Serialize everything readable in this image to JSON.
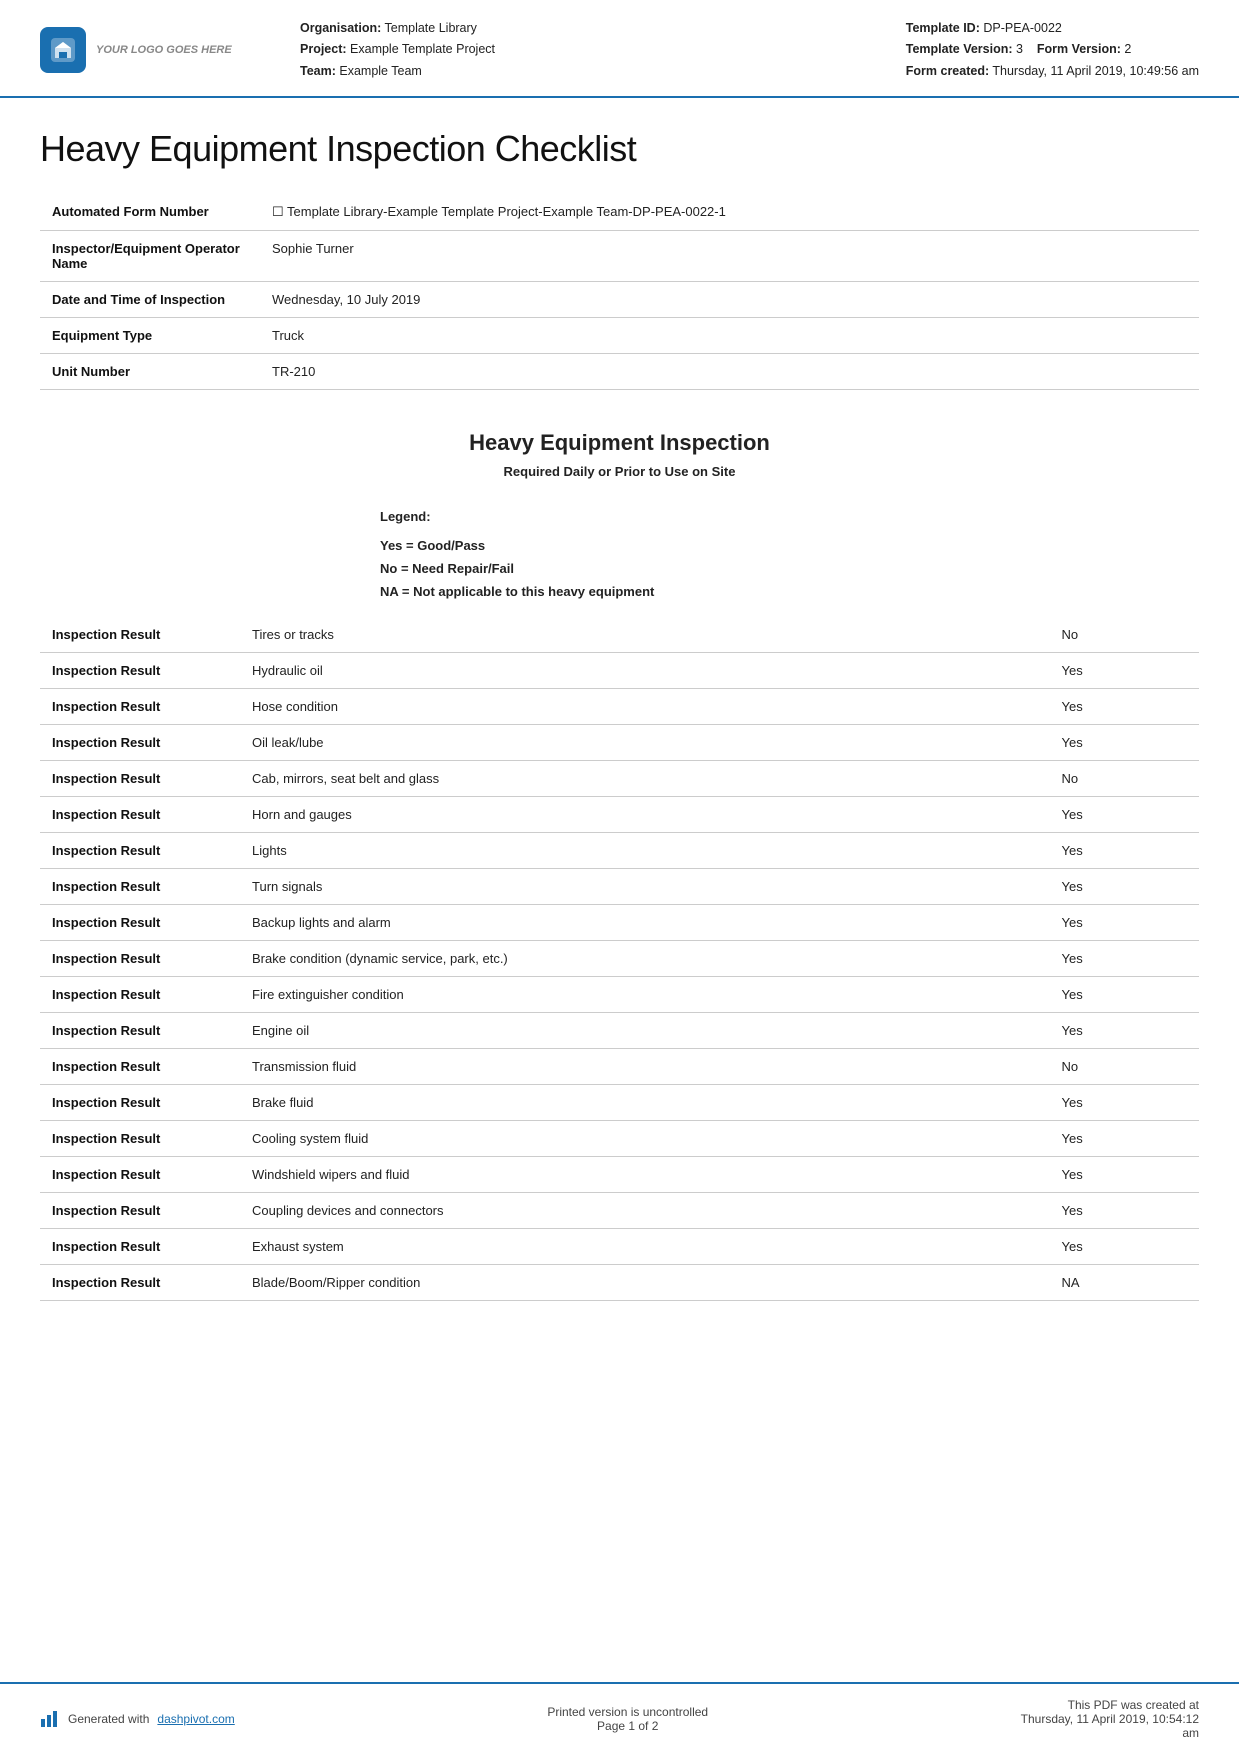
{
  "header": {
    "logo_alt": "Your Logo Goes Here",
    "org_label": "Organisation:",
    "org_value": "Template Library",
    "project_label": "Project:",
    "project_value": "Example Template Project",
    "team_label": "Team:",
    "team_value": "Example Team",
    "template_id_label": "Template ID:",
    "template_id_value": "DP-PEA-0022",
    "template_version_label": "Template Version:",
    "template_version_value": "3",
    "form_version_label": "Form Version:",
    "form_version_value": "2",
    "form_created_label": "Form created:",
    "form_created_value": "Thursday, 11 April 2019, 10:49:56 am"
  },
  "page_title": "Heavy Equipment Inspection Checklist",
  "info_rows": [
    {
      "label": "Automated Form Number",
      "value": "☐ Template Library-Example Template Project-Example Team-DP-PEA-0022-1"
    },
    {
      "label": "Inspector/Equipment Operator Name",
      "value": "Sophie Turner"
    },
    {
      "label": "Date and Time of Inspection",
      "value": "Wednesday, 10 July 2019"
    },
    {
      "label": "Equipment Type",
      "value": "Truck"
    },
    {
      "label": "Unit Number",
      "value": "TR-210"
    }
  ],
  "section": {
    "title": "Heavy Equipment Inspection",
    "subtitle": "Required Daily or Prior to Use on Site",
    "legend_title": "Legend:",
    "legend_items": [
      "Yes = Good/Pass",
      "No = Need Repair/Fail",
      "NA = Not applicable to this heavy equipment"
    ]
  },
  "inspection_rows": [
    {
      "label": "Inspection Result",
      "item": "Tires or tracks",
      "result": "No",
      "notes": ""
    },
    {
      "label": "Inspection Result",
      "item": "Hydraulic oil",
      "result": "Yes",
      "notes": ""
    },
    {
      "label": "Inspection Result",
      "item": "Hose condition",
      "result": "Yes",
      "notes": ""
    },
    {
      "label": "Inspection Result",
      "item": "Oil leak/lube",
      "result": "Yes",
      "notes": ""
    },
    {
      "label": "Inspection Result",
      "item": "Cab, mirrors, seat belt and glass",
      "result": "No",
      "notes": ""
    },
    {
      "label": "Inspection Result",
      "item": "Horn and gauges",
      "result": "Yes",
      "notes": ""
    },
    {
      "label": "Inspection Result",
      "item": "Lights",
      "result": "Yes",
      "notes": ""
    },
    {
      "label": "Inspection Result",
      "item": "Turn signals",
      "result": "Yes",
      "notes": ""
    },
    {
      "label": "Inspection Result",
      "item": "Backup lights and alarm",
      "result": "Yes",
      "notes": ""
    },
    {
      "label": "Inspection Result",
      "item": "Brake condition (dynamic service, park, etc.)",
      "result": "Yes",
      "notes": ""
    },
    {
      "label": "Inspection Result",
      "item": "Fire extinguisher condition",
      "result": "Yes",
      "notes": ""
    },
    {
      "label": "Inspection Result",
      "item": "Engine oil",
      "result": "Yes",
      "notes": ""
    },
    {
      "label": "Inspection Result",
      "item": "Transmission fluid",
      "result": "No",
      "notes": ""
    },
    {
      "label": "Inspection Result",
      "item": "Brake fluid",
      "result": "Yes",
      "notes": ""
    },
    {
      "label": "Inspection Result",
      "item": "Cooling system fluid",
      "result": "Yes",
      "notes": ""
    },
    {
      "label": "Inspection Result",
      "item": "Windshield wipers and fluid",
      "result": "Yes",
      "notes": ""
    },
    {
      "label": "Inspection Result",
      "item": "Coupling devices and connectors",
      "result": "Yes",
      "notes": ""
    },
    {
      "label": "Inspection Result",
      "item": "Exhaust system",
      "result": "Yes",
      "notes": ""
    },
    {
      "label": "Inspection Result",
      "item": "Blade/Boom/Ripper condition",
      "result": "NA",
      "notes": ""
    }
  ],
  "footer": {
    "generated_text": "Generated with",
    "link_text": "dashpivot.com",
    "link_url": "dashpivot.com",
    "center_text": "Printed version is uncontrolled\nPage 1 of 2",
    "right_text": "This PDF was created at\nThursday, 11 April 2019, 10:54:12\nam"
  }
}
